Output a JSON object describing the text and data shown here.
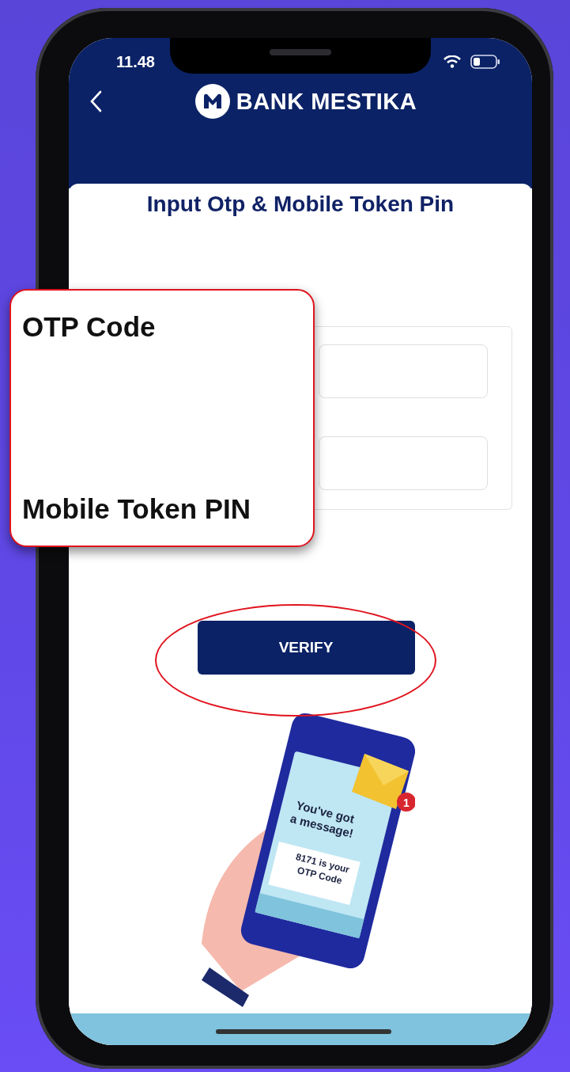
{
  "status_bar": {
    "time": "11.48"
  },
  "app_bar": {
    "brand": "BANK MESTIKA"
  },
  "page_title": "Input Otp & Mobile Token Pin",
  "callout": {
    "labels": [
      "OTP Code",
      "Mobile Token PIN"
    ]
  },
  "verify_button": {
    "label": "VERIFY"
  },
  "illustration": {
    "headline_lines": [
      "You've got",
      "a message!"
    ],
    "message_lines": [
      "8171 is your",
      "OTP Code"
    ],
    "badge": "1"
  }
}
